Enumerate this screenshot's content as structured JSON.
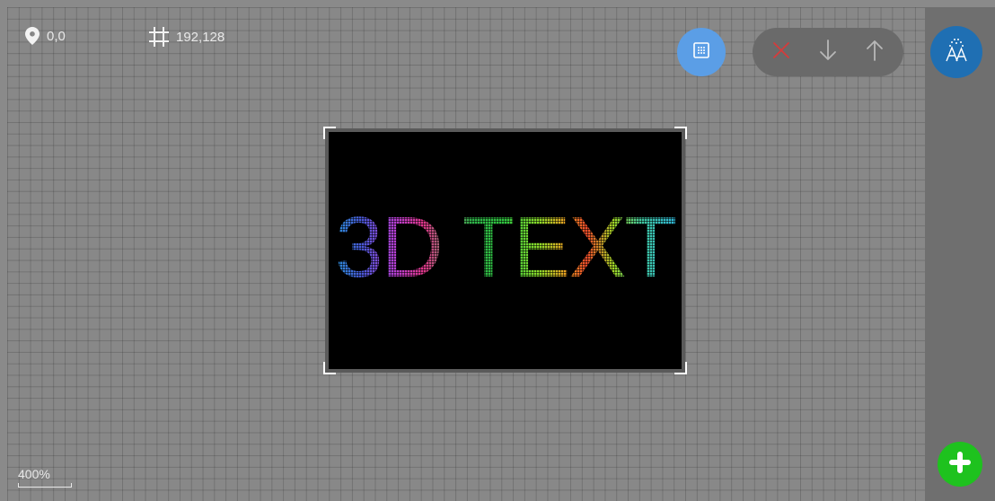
{
  "toolbar": {
    "position_readout": "0,0",
    "size_readout": "192,128",
    "icons": {
      "position": "location-pin-icon",
      "size": "crop-frame-icon",
      "grid_toggle": "grid-dots-icon",
      "delete": "close-icon",
      "move_down": "arrow-down-icon",
      "move_up": "arrow-up-icon",
      "font": "font-style-icon",
      "add": "plus-icon"
    }
  },
  "screen": {
    "text": "3D TEXT",
    "background": "#000000"
  },
  "footer": {
    "zoom_label": "400%"
  },
  "colors": {
    "grid_button": "#5b9ee6",
    "font_button": "#1f6fb3",
    "add_button": "#1ec21e",
    "delete_icon": "#d63b3b"
  }
}
